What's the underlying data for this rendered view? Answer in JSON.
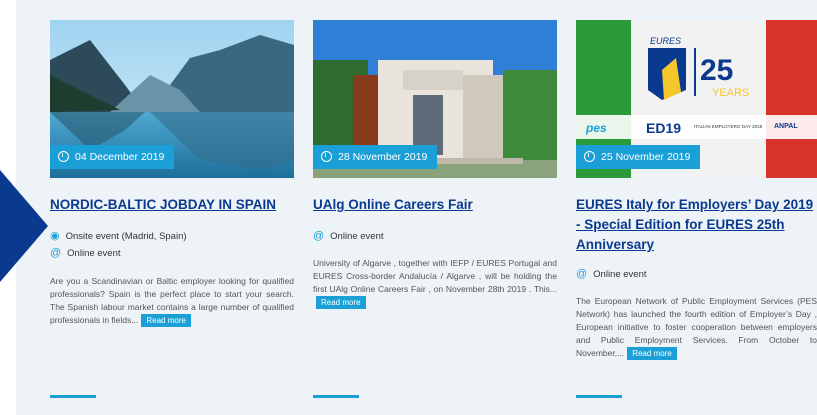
{
  "cards": [
    {
      "date": "04 December 2019",
      "title": "NORDIC-BALTIC JOBDAY IN SPAIN",
      "meta": [
        {
          "icon": "location-pin-icon",
          "text": "Onsite event (Madrid, Spain)"
        },
        {
          "icon": "at-sign-icon",
          "text": "Online event"
        }
      ],
      "description": "Are you a Scandinavian or Baltic employer looking for qualified professionals? Spain is the perfect place to start your search. The Spanish labour market contains a large number of qualified professionals in fields...",
      "read_more": "Read more"
    },
    {
      "date": "28 November 2019",
      "title": "UAlg Online Careers Fair",
      "meta": [
        {
          "icon": "at-sign-icon",
          "text": "Online event"
        }
      ],
      "description": "University of Algarve , together with IEFP / EURES Portugal and EURES Cross-border Andalucía / Algarve , will be holding the first UAlg Online Careers Fair , on November 28th 2019 . This...",
      "read_more": "Read more"
    },
    {
      "date": "25 November 2019",
      "title": "EURES Italy for Employers’ Day 2019 - Special Edition for EURES 25th Anniversary",
      "meta": [
        {
          "icon": "at-sign-icon",
          "text": "Online event"
        }
      ],
      "description": "The European Network of Public Employment Services (PES Network) has launched the fourth edition of Employer’s Day , European initiative to foster cooperation between employers and Public Employment Services. From October to November,...",
      "read_more": "Read more"
    }
  ],
  "banner": {
    "eures": "EURES",
    "num": "25",
    "years": "YEARS",
    "pes": "pes",
    "ed": "ED19",
    "ed_caption": "ITALIAN EMPLOYERS' DAY 2019",
    "anpal": "ANPAL"
  },
  "colors": {
    "accent": "#1aa0d6",
    "title": "#0a3a8f",
    "band": "#eef3f7"
  }
}
